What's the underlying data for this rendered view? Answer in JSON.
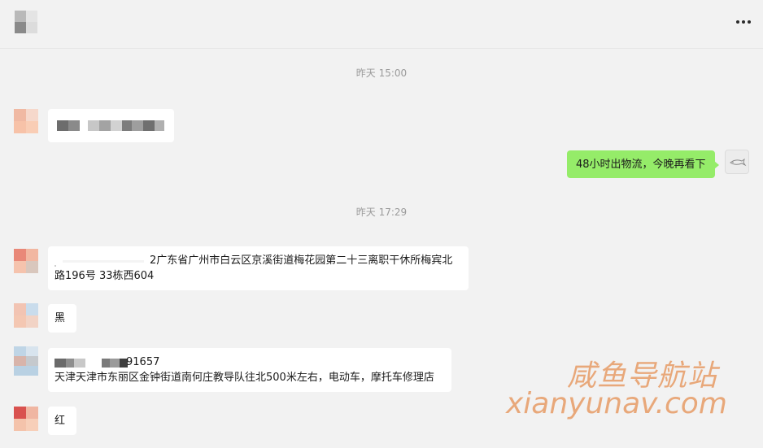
{
  "header": {
    "more_icon": "more-horizontal-icon"
  },
  "messages": {
    "timestamp_1": "昨天 15:00",
    "sent_1": "48小时出物流，今晚再看下",
    "timestamp_2": "昨天 17:29",
    "addr_1_line1": "2广东省广州市白云区京溪街道梅花园第二十三离职干休所梅宾北",
    "addr_1_line2": "路196号 33栋西604",
    "msg_black": "黑",
    "addr_2_phone_tail": "91657",
    "addr_2_line2": "天津天津市东丽区金钟街道南何庄教导队往北500米左右，电动车，摩托车修理店",
    "msg_red": "红"
  },
  "watermark": {
    "title": "咸鱼导航站",
    "url": "xianyunav.com"
  },
  "colors": {
    "background": "#f2f2f2",
    "sent_bubble": "#95ec69",
    "received_bubble": "#ffffff",
    "watermark": "#e8a06e"
  }
}
